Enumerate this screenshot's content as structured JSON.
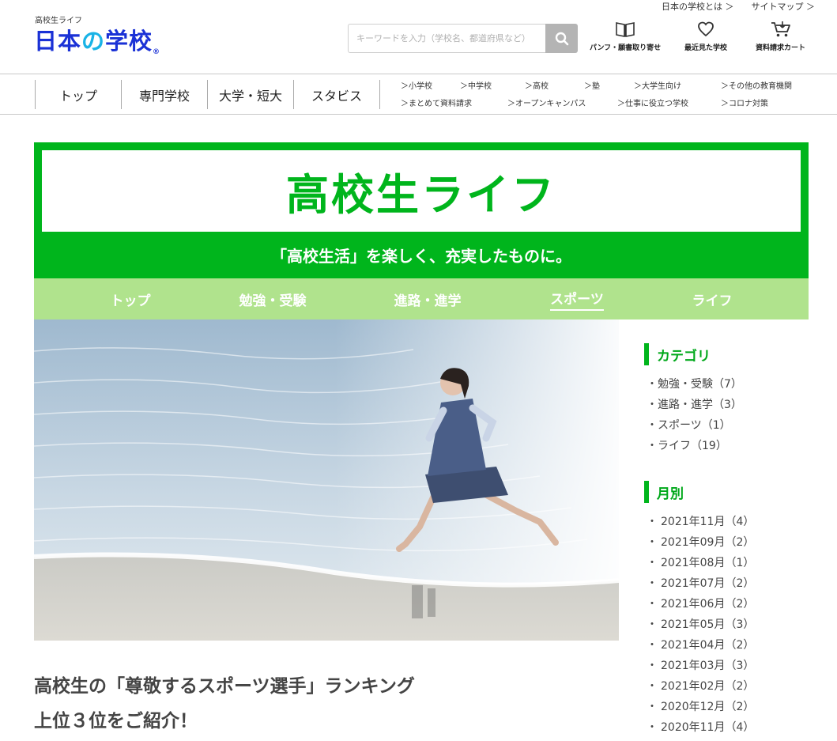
{
  "top_links": [
    "日本の学校とは ＞",
    "サイトマップ ＞"
  ],
  "logo": {
    "subtitle": "高校生ライフ",
    "part1": "日本",
    "part2": "の",
    "part3": "学校",
    "reg": "®"
  },
  "search": {
    "placeholder": "キーワードを入力（学校名、都道府県など）",
    "icon": "magnifier-icon"
  },
  "header_icons": [
    {
      "label": "パンフ・願書取り寄せ",
      "icon": "book-icon"
    },
    {
      "label": "最近見た学校",
      "icon": "heart-icon"
    },
    {
      "label": "資料請求カート",
      "icon": "cart-icon"
    }
  ],
  "global_nav": [
    "トップ",
    "専門学校",
    "大学・短大",
    "スタビス"
  ],
  "sub_links": {
    "row1": [
      "＞小学校",
      "＞中学校",
      "＞高校",
      "＞塾",
      "＞大学生向け",
      "＞その他の教育機関"
    ],
    "row2": [
      "＞まとめて資料請求",
      "＞オープンキャンパス",
      "＞仕事に役立つ学校",
      "＞コロナ対策"
    ]
  },
  "banner": {
    "title": "高校生ライフ",
    "subtitle": "「高校生活」を楽しく、充実したものに。",
    "color": "#00b51c"
  },
  "sub_nav": {
    "items": [
      "トップ",
      "勉強・受験",
      "進路・進学",
      "スポーツ",
      "ライフ"
    ],
    "active": "スポーツ"
  },
  "article": {
    "title_line1": "高校生の「尊敬するスポーツ選手」ランキング",
    "title_line2": "上位３位をご紹介！"
  },
  "sidebar": {
    "category_heading": "カテゴリ",
    "categories": [
      "勉強・受験（7）",
      "進路・進学（3）",
      "スポーツ（1）",
      "ライフ（19）"
    ],
    "monthly_heading": "月別",
    "months": [
      "2021年11月（4）",
      "2021年09月（2）",
      "2021年08月（1）",
      "2021年07月（2）",
      "2021年06月（2）",
      "2021年05月（3）",
      "2021年04月（2）",
      "2021年03月（3）",
      "2021年02月（2）",
      "2020年12月（2）",
      "2020年11月（4）"
    ],
    "bullet": "・"
  }
}
